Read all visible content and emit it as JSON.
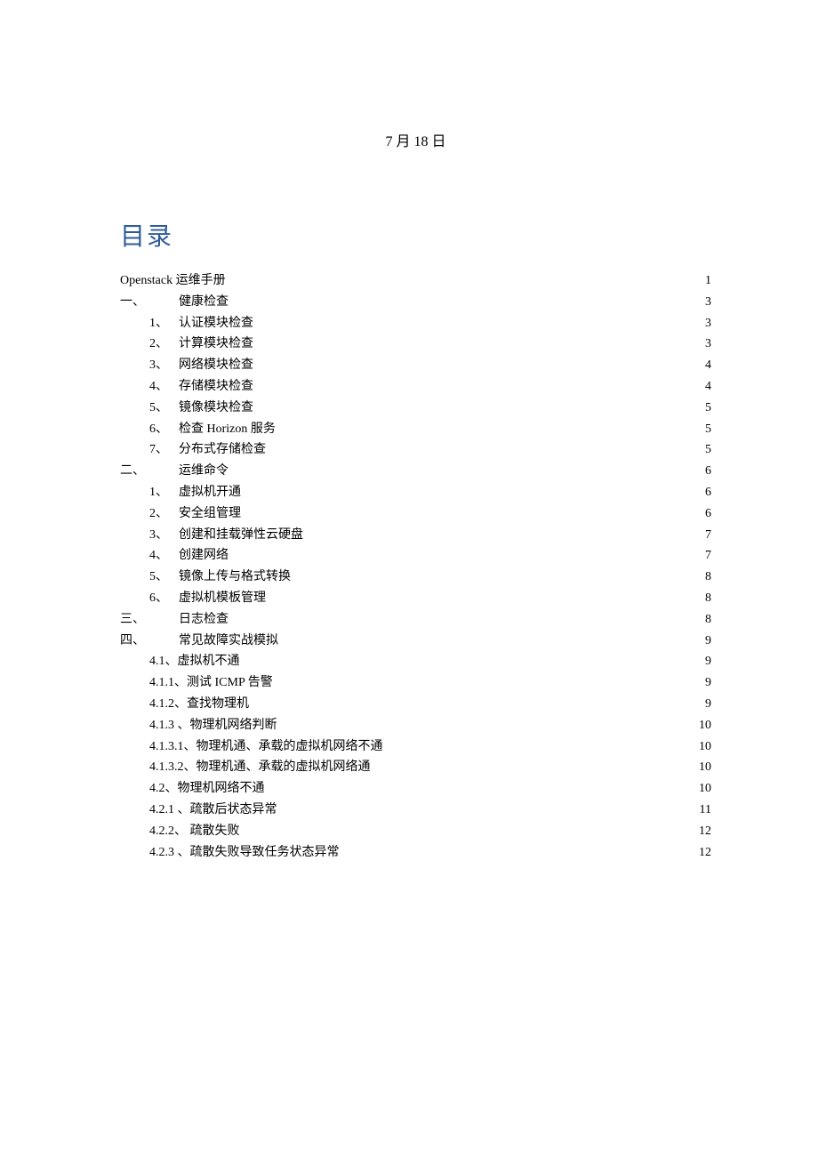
{
  "date": "7 月 18 日",
  "toc_title": "目录",
  "entries": [
    {
      "indent": "indent-0",
      "prefix": "",
      "label": "Openstack 运维手册 ",
      "page": "1"
    },
    {
      "indent": "indent-0-num",
      "prefix": "一、",
      "label": "健康检查 ",
      "page": "3"
    },
    {
      "indent": "indent-1",
      "prefix": "1、",
      "label": "认证模块检查 ",
      "page": "3"
    },
    {
      "indent": "indent-1",
      "prefix": "2、",
      "label": "计算模块检查 ",
      "page": "3"
    },
    {
      "indent": "indent-1",
      "prefix": "3、",
      "label": "网络模块检查 ",
      "page": "4"
    },
    {
      "indent": "indent-1",
      "prefix": "4、",
      "label": "存储模块检查 ",
      "page": "4"
    },
    {
      "indent": "indent-1",
      "prefix": "5、",
      "label": "镜像模块检查 ",
      "page": "5"
    },
    {
      "indent": "indent-1",
      "prefix": "6、",
      "label": "检查 Horizon 服务",
      "page": "5"
    },
    {
      "indent": "indent-1",
      "prefix": "7、",
      "label": "分布式存储检查 ",
      "page": "5"
    },
    {
      "indent": "indent-0-num",
      "prefix": "二、",
      "label": "运维命令 ",
      "page": "6"
    },
    {
      "indent": "indent-1",
      "prefix": "1、",
      "label": "虚拟机开通 ",
      "page": "6"
    },
    {
      "indent": "indent-1",
      "prefix": "2、",
      "label": "安全组管理 ",
      "page": "6"
    },
    {
      "indent": "indent-1",
      "prefix": "3、",
      "label": "创建和挂载弹性云硬盘 ",
      "page": "7"
    },
    {
      "indent": "indent-1",
      "prefix": "4、",
      "label": "创建网络 ",
      "page": "7"
    },
    {
      "indent": "indent-1",
      "prefix": "5、",
      "label": "镜像上传与格式转换 ",
      "page": "8"
    },
    {
      "indent": "indent-1",
      "prefix": "6、",
      "label": "虚拟机模板管理 ",
      "page": "8"
    },
    {
      "indent": "indent-0-num",
      "prefix": "三、",
      "label": "日志检查 ",
      "page": "8"
    },
    {
      "indent": "indent-0-num",
      "prefix": "四、",
      "label": "常见故障实战模拟 ",
      "page": "9"
    },
    {
      "indent": "indent-1",
      "prefix": "",
      "label": "4.1、虚拟机不通 ",
      "page": "9"
    },
    {
      "indent": "indent-1",
      "prefix": "",
      "label": "4.1.1、测试 ICMP 告警",
      "page": "9"
    },
    {
      "indent": "indent-1",
      "prefix": "",
      "label": "4.1.2、查找物理机 ",
      "page": "9"
    },
    {
      "indent": "indent-1",
      "prefix": "",
      "label": "4.1.3 、物理机网络判断 ",
      "page": "10"
    },
    {
      "indent": "indent-1",
      "prefix": "",
      "label": "4.1.3.1、物理机通、承载的虚拟机网络不通",
      "page": "10"
    },
    {
      "indent": "indent-1",
      "prefix": "",
      "label": "4.1.3.2、物理机通、承载的虚拟机网络通",
      "page": "10"
    },
    {
      "indent": "indent-1",
      "prefix": "",
      "label": "4.2、物理机网络不通 ",
      "page": "10"
    },
    {
      "indent": "indent-1",
      "prefix": "",
      "label": "4.2.1 、疏散后状态异常 ",
      "page": "11"
    },
    {
      "indent": "indent-1",
      "prefix": "",
      "label": "4.2.2、 疏散失败 ",
      "page": "12"
    },
    {
      "indent": "indent-1",
      "prefix": "",
      "label": "4.2.3 、疏散失败导致任务状态异常",
      "page": "12"
    }
  ]
}
